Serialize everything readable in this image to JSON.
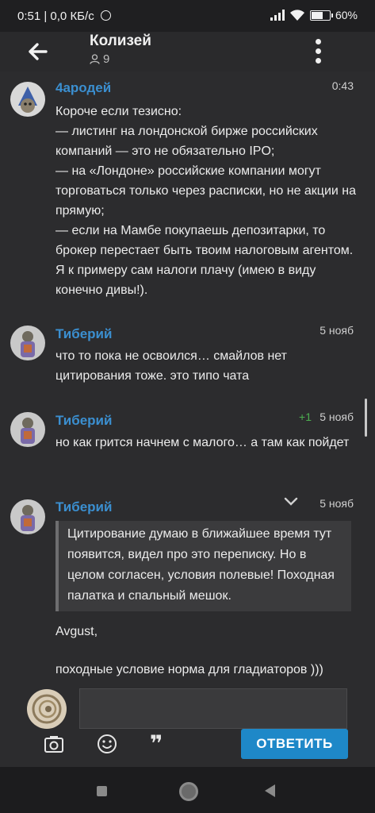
{
  "status_bar": {
    "left": "0:51 | 0,0 КБ/с",
    "battery": "60%"
  },
  "header": {
    "title": "Колизей",
    "member_count": "9"
  },
  "messages": [
    {
      "author": "4ародей",
      "time": "0:43",
      "lines": [
        "Короче если тезисно:",
        "— листинг на лондонской бирже российских компаний — это не обязательно IPO;",
        "— на «Лондоне» российские компании могут торговаться только через расписки, но не акции на прямую;",
        "— если на Мамбе покупаешь депозитарки, то брокер перестает быть твоим налоговым агентом. Я к примеру сам налоги плачу (имею в виду конечно дивы!)."
      ]
    },
    {
      "author": "Тиберий",
      "time": "5 нояб",
      "text": "что то пока не освоился… смайлов нет цитирования тоже. это типо чата"
    },
    {
      "author": "Тиберий",
      "time": "5 нояб",
      "reaction": "+1",
      "text": "но как грится начнем с малого… а там как пойдет"
    },
    {
      "author": "Тиберий",
      "time": "5 нояб",
      "quote": "Цитирование думаю в ближайшее время тут появится, видел про это переписку. Но в целом согласен, условия полевые! Походная палатка и спальный мешок.",
      "addressee": "Avgust,",
      "text": "походные условие норма для гладиаторов )))"
    }
  ],
  "composer": {
    "reply_button": "ОТВЕТИТЬ",
    "quote_glyph": "❞"
  },
  "colors": {
    "author": "#3b8fd0",
    "reply_button": "#1e88c8",
    "reaction": "#4caf50"
  }
}
